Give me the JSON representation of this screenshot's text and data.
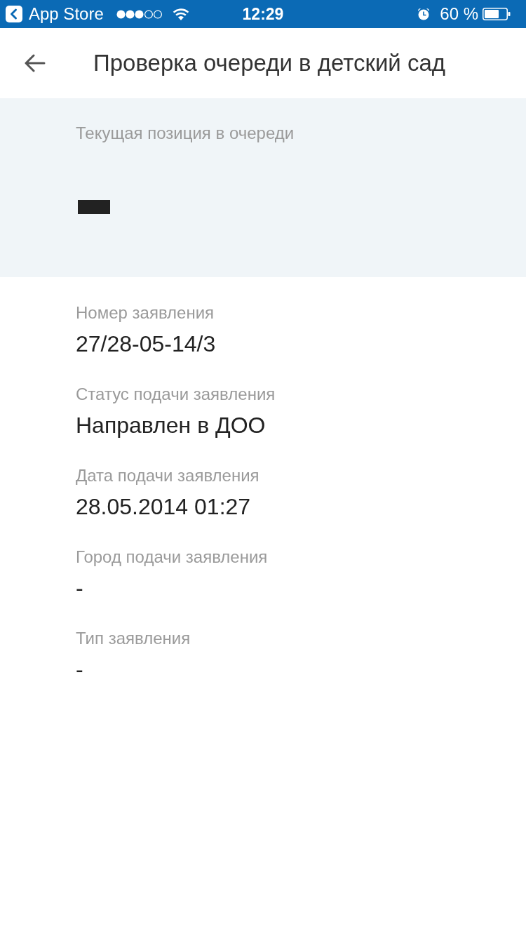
{
  "status_bar": {
    "back_app": "App Store",
    "time": "12:29",
    "battery": "60 %"
  },
  "header": {
    "title": "Проверка очереди в детский сад"
  },
  "queue_position": {
    "label": "Текущая позиция в очереди",
    "value_redacted": true
  },
  "fields": [
    {
      "label": "Номер заявления",
      "value": "27/28-05-14/3"
    },
    {
      "label": "Статус подачи заявления",
      "value": "Направлен в ДОО"
    },
    {
      "label": "Дата подачи заявления",
      "value": "28.05.2014 01:27"
    },
    {
      "label": "Город подачи заявления",
      "value": "-"
    },
    {
      "label": "Тип заявления",
      "value": "-"
    }
  ]
}
